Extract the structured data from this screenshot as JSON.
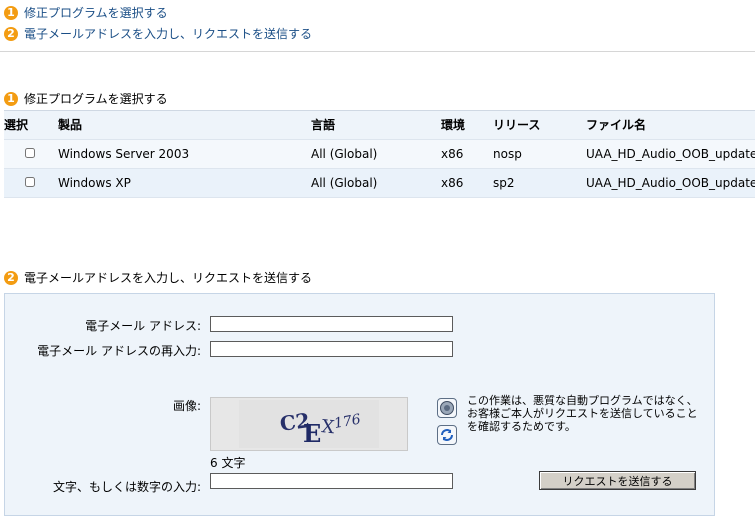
{
  "toc": [
    {
      "num": "1",
      "label": "修正プログラムを選択する"
    },
    {
      "num": "2",
      "label": "電子メールアドレスを入力し、リクエストを送信する"
    }
  ],
  "section1": {
    "num": "1",
    "title": "修正プログラムを選択する",
    "columns": {
      "select": "選択",
      "product": "製品",
      "language": "言語",
      "environment": "環境",
      "release": "リリース",
      "filename": "ファイル名"
    },
    "rows": [
      {
        "checked": false,
        "product": "Windows Server 2003",
        "language": "All (Global)",
        "environment": "x86",
        "release": "nosp",
        "filename": "UAA_HD_Audio_OOB_update"
      },
      {
        "checked": false,
        "product": "Windows XP",
        "language": "All (Global)",
        "environment": "x86",
        "release": "sp2",
        "filename": "UAA_HD_Audio_OOB_update"
      }
    ]
  },
  "section2": {
    "num": "2",
    "title": "電子メールアドレスを入力し、リクエストを送信する",
    "email_label": "電子メール アドレス:",
    "email_value": "",
    "email_confirm_label": "電子メール アドレスの再入力:",
    "email_confirm_value": "",
    "image_label": "画像:",
    "captcha_text": "C2EX176",
    "char_count": "6 文字",
    "note": "この作業は、悪質な自動プログラムではなく、お客様ご本人がリクエストを送信していることを確認するためです。",
    "input_label": "文字、もしくは数字の入力:",
    "input_value": "",
    "submit_label": "リクエストを送信する",
    "audio_icon": "speaker-icon",
    "refresh_icon": "refresh-icon"
  },
  "colors": {
    "accent": "#f39c12",
    "link": "#1a4e86",
    "panel": "#eef4fa",
    "border": "#c6d5e6"
  }
}
